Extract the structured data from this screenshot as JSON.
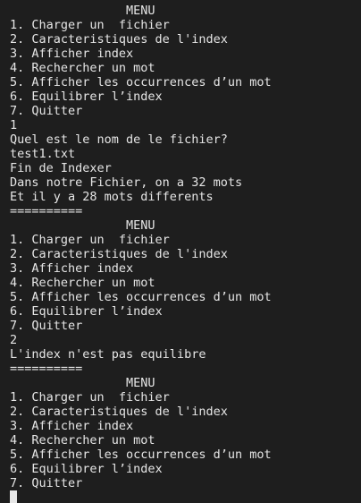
{
  "terminal": {
    "lines": [
      "                MENU",
      "1. Charger un  fichier",
      "2. Caracteristiques de l'index",
      "3. Afficher index",
      "4. Rechercher un mot",
      "5. Afficher les occurrences d’un mot",
      "6. Equilibrer l’index",
      "7. Quitter",
      "1",
      "Quel est le nom de le fichier?",
      "test1.txt",
      "Fin de Indexer",
      "Dans notre Fichier, on a 32 mots",
      "Et il y a 28 mots differents",
      "==========",
      "                MENU",
      "1. Charger un  fichier",
      "2. Caracteristiques de l'index",
      "3. Afficher index",
      "4. Rechercher un mot",
      "5. Afficher les occurrences d’un mot",
      "6. Equilibrer l’index",
      "7. Quitter",
      "2",
      "L'index n'est pas equilibre",
      "==========",
      "                MENU",
      "1. Charger un  fichier",
      "2. Caracteristiques de l'index",
      "3. Afficher index",
      "4. Rechercher un mot",
      "5. Afficher les occurrences d’un mot",
      "6. Equilibrer l’index",
      "7. Quitter"
    ]
  },
  "colors": {
    "background": "#1e1e1e",
    "foreground": "#e6e6e6"
  }
}
